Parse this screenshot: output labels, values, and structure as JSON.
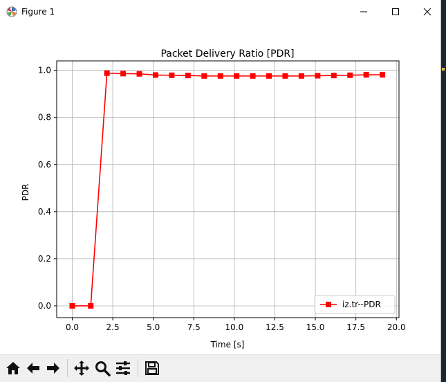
{
  "window": {
    "title": "Figure 1",
    "app_icon": "matplotlib-icon",
    "buttons": [
      "minimize",
      "maximize",
      "close"
    ]
  },
  "toolbar": {
    "tools": [
      {
        "name": "home",
        "icon": "home-icon"
      },
      {
        "name": "back",
        "icon": "arrow-left-icon"
      },
      {
        "name": "forward",
        "icon": "arrow-right-icon"
      },
      {
        "name": "pan",
        "icon": "move-icon"
      },
      {
        "name": "zoom",
        "icon": "zoom-icon"
      },
      {
        "name": "configure-subplots",
        "icon": "sliders-icon"
      },
      {
        "name": "save",
        "icon": "save-icon"
      }
    ]
  },
  "chart_data": {
    "type": "line",
    "title": "Packet Delivery Ratio [PDR]",
    "xlabel": "Time [s]",
    "ylabel": "PDR",
    "xlim": [
      -0.96,
      20.16
    ],
    "ylim": [
      -0.05,
      1.04
    ],
    "x_ticks": [
      0.0,
      2.5,
      5.0,
      7.5,
      10.0,
      12.5,
      15.0,
      17.5,
      20.0
    ],
    "x_tick_labels": [
      "0.0",
      "2.5",
      "5.0",
      "7.5",
      "10.0",
      "12.5",
      "15.0",
      "17.5",
      "20.0"
    ],
    "y_ticks": [
      0.0,
      0.2,
      0.4,
      0.6,
      0.8,
      1.0
    ],
    "y_tick_labels": [
      "0.0",
      "0.2",
      "0.4",
      "0.6",
      "0.8",
      "1.0"
    ],
    "grid": true,
    "legend_position": "lower-right",
    "series": [
      {
        "name": "iz.tr--PDR",
        "color": "#ff0000",
        "marker": "square",
        "x": [
          0.0,
          1.14,
          2.14,
          3.14,
          4.14,
          5.14,
          6.14,
          7.14,
          8.14,
          9.14,
          10.14,
          11.14,
          12.14,
          13.14,
          14.14,
          15.14,
          16.14,
          17.14,
          18.14,
          19.14
        ],
        "y": [
          0.0,
          0.0,
          0.988,
          0.986,
          0.985,
          0.98,
          0.979,
          0.978,
          0.976,
          0.976,
          0.976,
          0.976,
          0.976,
          0.976,
          0.976,
          0.977,
          0.978,
          0.979,
          0.981,
          0.981
        ]
      }
    ]
  }
}
